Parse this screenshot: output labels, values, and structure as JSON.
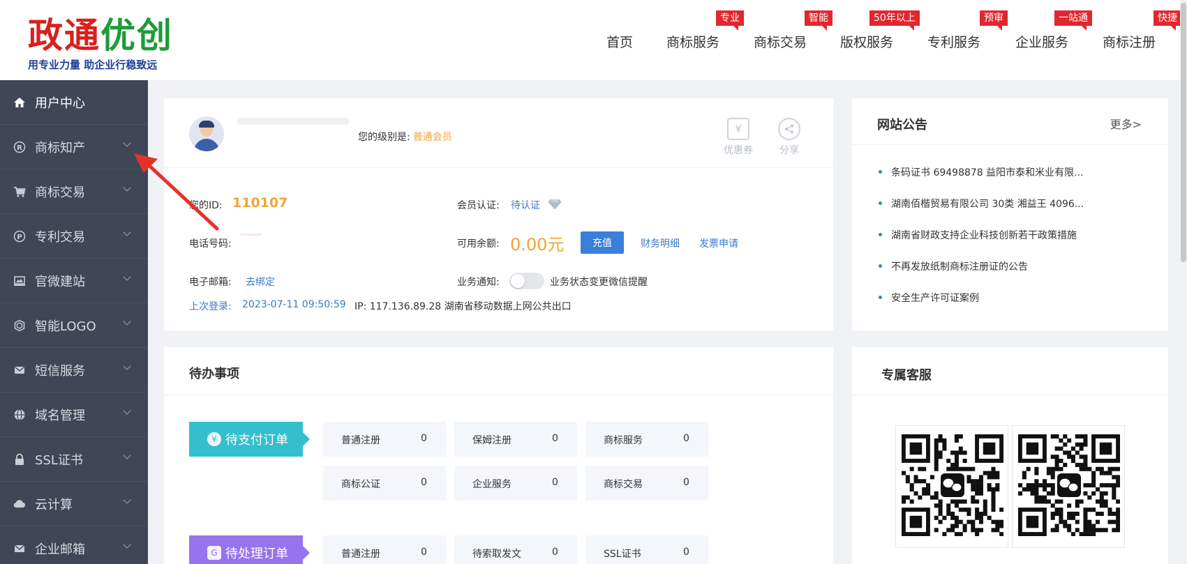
{
  "header": {
    "logo_title_part1": "政通",
    "logo_title_part2": "优创",
    "logo_slogan": "用专业力量  助企业行稳致远",
    "nav": [
      {
        "label": "首页",
        "badge": ""
      },
      {
        "label": "商标服务",
        "badge": "专业"
      },
      {
        "label": "商标交易",
        "badge": "智能"
      },
      {
        "label": "版权服务",
        "badge": "50年以上"
      },
      {
        "label": "专利服务",
        "badge": "预审"
      },
      {
        "label": "企业服务",
        "badge": "一站通"
      },
      {
        "label": "商标注册",
        "badge": "快捷"
      }
    ]
  },
  "sidebar": {
    "items": [
      {
        "label": "用户中心",
        "icon": "home-icon"
      },
      {
        "label": "商标知产",
        "icon": "registered-icon"
      },
      {
        "label": "商标交易",
        "icon": "cart-icon"
      },
      {
        "label": "专利交易",
        "icon": "patent-icon"
      },
      {
        "label": "官微建站",
        "icon": "monitor-icon"
      },
      {
        "label": "智能LOGO",
        "icon": "hexagon-icon"
      },
      {
        "label": "短信服务",
        "icon": "mail-icon"
      },
      {
        "label": "域名管理",
        "icon": "globe-icon"
      },
      {
        "label": "SSL证书",
        "icon": "lock-icon"
      },
      {
        "label": "云计算",
        "icon": "cloud-icon"
      },
      {
        "label": "企业邮箱",
        "icon": "envelope-icon"
      }
    ]
  },
  "user": {
    "level_label": "您的级别是:",
    "level_value": "普通会员",
    "coupon_label": "优惠券",
    "share_label": "分享",
    "id_label": "您的ID:",
    "id_value": "110107",
    "phone_label": "电话号码:",
    "email_label": "电子邮箱:",
    "email_action": "去绑定",
    "cert_label": "会员认证:",
    "cert_value": "待认证",
    "balance_label": "可用余额:",
    "balance_value": "0.00元",
    "recharge_button": "充值",
    "finance_link": "财务明细",
    "invoice_link": "发票申请",
    "notify_label": "业务通知:",
    "notify_desc": "业务状态变更微信提醒",
    "last_login_label": "上次登录:",
    "last_login_time": "2023-07-11 09:50:59",
    "ip_text": "IP: 117.136.89.28 湖南省移动数据上网公共出口"
  },
  "notice": {
    "title": "网站公告",
    "more": "更多>",
    "items": [
      "条码证书 69498878 益阳市泰和米业有限...",
      "湖南佰楷贸易有限公司 30类 湘益王 4096...",
      "湖南省财政支持企业科技创新若干政策措施",
      "不再发放纸制商标注册证的公告",
      "安全生产许可证案例"
    ]
  },
  "todo": {
    "title": "待办事项",
    "pending_payment_label": "待支付订单",
    "pending_payment": [
      {
        "label": "普通注册",
        "count": "0"
      },
      {
        "label": "保姆注册",
        "count": "0"
      },
      {
        "label": "商标服务",
        "count": "0"
      },
      {
        "label": "商标公证",
        "count": "0"
      },
      {
        "label": "企业服务",
        "count": "0"
      },
      {
        "label": "商标交易",
        "count": "0"
      }
    ],
    "pending_process_label": "待处理订单",
    "pending_process": [
      {
        "label": "普通注册",
        "count": "0"
      },
      {
        "label": "待索取发文",
        "count": "0"
      },
      {
        "label": "SSL证书",
        "count": "0"
      }
    ]
  },
  "service": {
    "title": "专属客服"
  },
  "colors": {
    "accent_blue": "#3a7fd9",
    "orange": "#f2a33a",
    "red": "#e2262f",
    "sidebar_bg": "#3f4756"
  }
}
